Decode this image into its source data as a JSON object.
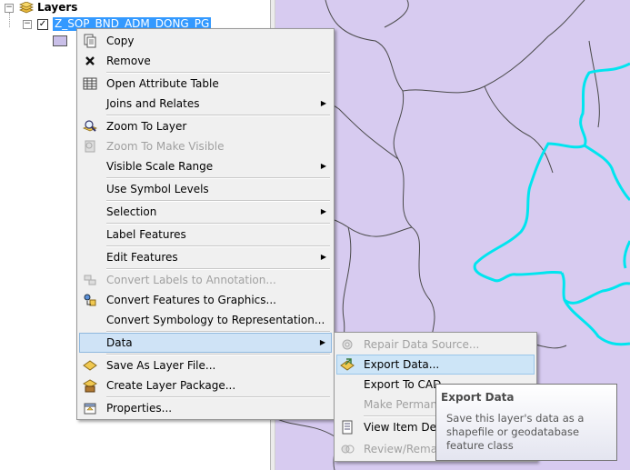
{
  "toc": {
    "root_label": "Layers",
    "layer_name": "Z_SOP_BND_ADM_DONG_PG",
    "layer_checked": true,
    "expand_root": "⊟",
    "expand_layer": "⊟",
    "symbol_color": "#c9bfe8"
  },
  "map": {
    "fill_color": "#d7cbf0",
    "boundary_color": "#4a4a4a",
    "highlight_color": "#00e5ef"
  },
  "context_menu": {
    "items": [
      {
        "label": "Copy",
        "icon": "copy-icon"
      },
      {
        "label": "Remove",
        "icon": "remove-icon"
      },
      {
        "label": "Open Attribute Table",
        "icon": "table-icon"
      },
      {
        "label": "Joins and Relates",
        "submenu": true
      },
      {
        "label": "Zoom To Layer",
        "icon": "zoom-layer-icon"
      },
      {
        "label": "Zoom To Make Visible",
        "icon": "zoom-visible-icon",
        "disabled": true
      },
      {
        "label": "Visible Scale Range",
        "submenu": true
      },
      {
        "label": "Use Symbol Levels"
      },
      {
        "label": "Selection",
        "submenu": true
      },
      {
        "label": "Label Features"
      },
      {
        "label": "Edit Features",
        "submenu": true
      },
      {
        "label": "Convert Labels to Annotation...",
        "icon": "annotation-icon",
        "disabled": true
      },
      {
        "label": "Convert Features to Graphics...",
        "icon": "graphics-icon"
      },
      {
        "label": "Convert Symbology to Representation..."
      },
      {
        "label": "Data",
        "submenu": true,
        "active": true
      },
      {
        "label": "Save As Layer File...",
        "icon": "layer-file-icon"
      },
      {
        "label": "Create Layer Package...",
        "icon": "layer-package-icon"
      },
      {
        "label": "Properties...",
        "icon": "properties-icon"
      }
    ]
  },
  "data_submenu": {
    "items": [
      {
        "label": "Repair Data Source...",
        "disabled": true
      },
      {
        "label": "Export Data...",
        "highlighted": true
      },
      {
        "label": "Export To CAD"
      },
      {
        "label": "Make Permane",
        "disabled": true
      },
      {
        "label": "View Item Des"
      },
      {
        "label": "Review/Remat",
        "disabled": true
      }
    ]
  },
  "tooltip": {
    "title": "Export Data",
    "body": "Save this layer's data as a shapefile or geodatabase feature class"
  }
}
